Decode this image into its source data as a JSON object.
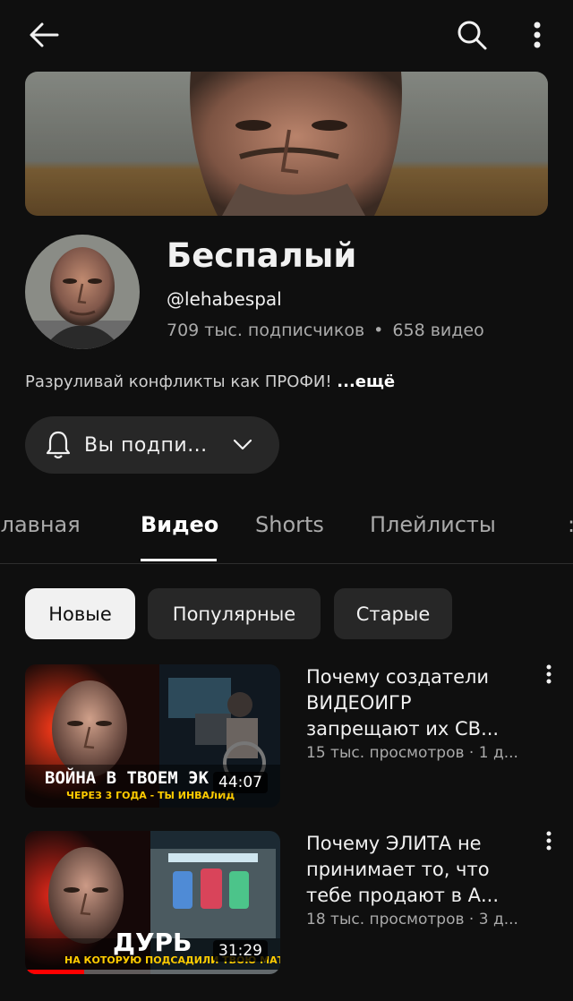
{
  "topbar": {
    "back_icon": "arrow-left-icon",
    "search_icon": "search-icon",
    "more_icon": "vertical-dots-icon"
  },
  "channel": {
    "name": "Беспалый",
    "handle": "@lehabespal",
    "subscribers": "709 тыс. подписчиков",
    "separator": "•",
    "videos": "658 видео",
    "description": "Разруливай конфликты как ПРОФИ!",
    "more_label": "...ещё"
  },
  "subscribe": {
    "label": "Вы подпи...",
    "bell_icon": "bell-icon",
    "chevron_icon": "chevron-down-icon"
  },
  "tabs": [
    {
      "label": "Главная"
    },
    {
      "label": "Видео"
    },
    {
      "label": "Shorts"
    },
    {
      "label": "Плейлисты"
    }
  ],
  "chips": [
    {
      "label": "Новые"
    },
    {
      "label": "Популярные"
    },
    {
      "label": "Старые"
    }
  ],
  "videos": [
    {
      "title": "Почему создатели ВИДЕОИГР запрещают их СВ...",
      "meta": "15 тыс. просмотров · 1 д...",
      "duration": "44:07",
      "thumb_text": "ВОЙНА В ТВОЕМ ЭК",
      "thumb_subtext": "ЧЕРЕЗ 3 ГОДА - ТЫ ИНВАЛИД"
    },
    {
      "title": "Почему ЭЛИТА не принимает то, что тебе продают в А...",
      "meta": "18 тыс. просмотров · 3 д...",
      "duration": "31:29",
      "thumb_text": "ДУРЬ",
      "thumb_subtext": "НА КОТОРУЮ ПОДСАДИЛИ ТВОЮ МАТЬ",
      "watched_fraction": 0.23
    }
  ],
  "colors": {
    "background": "#0f0f0f",
    "chip_active": "#f1f1f1",
    "chip": "#272727",
    "progress": "#ff0000",
    "muted": "#aaaaaa"
  }
}
